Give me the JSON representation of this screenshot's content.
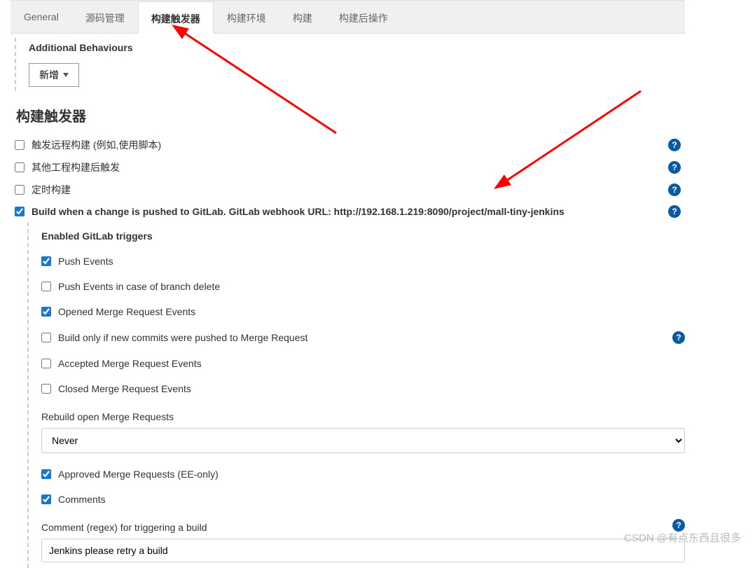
{
  "tabs": {
    "general": "General",
    "scm": "源码管理",
    "triggers": "构建触发器",
    "env": "构建环境",
    "build": "构建",
    "post": "构建后操作"
  },
  "additional": {
    "title": "Additional Behaviours",
    "addBtn": "新增"
  },
  "triggersSection": {
    "title": "构建触发器",
    "remote": "触发远程构建 (例如,使用脚本)",
    "other": "其他工程构建后触发",
    "timed": "定时构建",
    "gitlab": "Build when a change is pushed to GitLab. GitLab webhook URL: http://192.168.1.219:8090/project/mall-tiny-jenkins"
  },
  "enabled": {
    "title": "Enabled GitLab triggers",
    "push": "Push Events",
    "pushDelete": "Push Events in case of branch delete",
    "openedMR": "Opened Merge Request Events",
    "buildOnlyNew": "Build only if new commits were pushed to Merge Request",
    "acceptedMR": "Accepted Merge Request Events",
    "closedMR": "Closed Merge Request Events",
    "rebuildLabel": "Rebuild open Merge Requests",
    "rebuildValue": "Never",
    "approved": "Approved Merge Requests (EE-only)",
    "comments": "Comments",
    "commentRegexLabel": "Comment (regex) for triggering a build",
    "commentRegexValue": "Jenkins please retry a build"
  },
  "watermark": "CSDN @有点东西且很多"
}
